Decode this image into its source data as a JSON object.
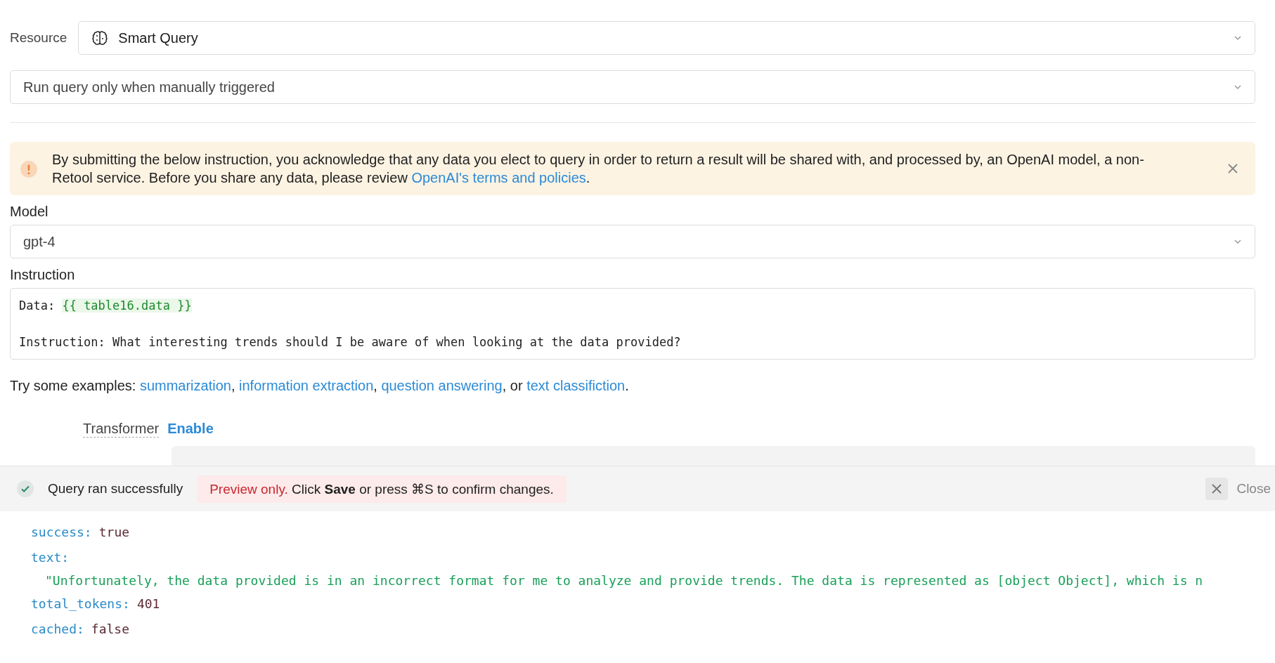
{
  "resource": {
    "label": "Resource",
    "value": "Smart Query"
  },
  "trigger": {
    "value": "Run query only when manually triggered"
  },
  "notice": {
    "text": "By submitting the below instruction, you acknowledge that any data you elect to query in order to return a result will be shared with, and processed by, an OpenAI model, a non-Retool service. Before you share any data, please review ",
    "link": "OpenAI's terms and policies",
    "end": "."
  },
  "model": {
    "label": "Model",
    "value": "gpt-4"
  },
  "instruction": {
    "label": "Instruction",
    "data_label": "Data: ",
    "binding": "{{ table16.data }}",
    "question": "Instruction: What interesting trends should I be aware of when looking at the data provided?"
  },
  "examples": [
    {
      "kind": "plain",
      "text": "Try some examples: "
    },
    {
      "kind": "link",
      "text": "summarization"
    },
    {
      "kind": "plain",
      "text": ", "
    },
    {
      "kind": "link",
      "text": "information extraction"
    },
    {
      "kind": "plain",
      "text": ", "
    },
    {
      "kind": "link",
      "text": "question answering"
    },
    {
      "kind": "plain",
      "text": ", or "
    },
    {
      "kind": "link",
      "text": "text classifiction"
    },
    {
      "kind": "plain",
      "text": "."
    }
  ],
  "transformer": {
    "label": "Transformer",
    "action": "Enable"
  },
  "result_bar": {
    "status": "Query ran successfully",
    "alert": "Preview only.",
    "message": "Click **Save** or press  ⌘S to confirm changes.",
    "close": "Close"
  },
  "output": [
    {
      "key": "success:",
      "value": "true",
      "kind": "boolean"
    },
    {
      "key": "text:",
      "value": "\"Unfortunately, the data provided is in an incorrect format for me to analyze and provide trends. The data is represented as [object Object], which is n",
      "kind": "string"
    },
    {
      "key": "total_tokens:",
      "value": "401",
      "kind": "number"
    },
    {
      "key": "cached:",
      "value": "false",
      "kind": "boolean"
    }
  ]
}
